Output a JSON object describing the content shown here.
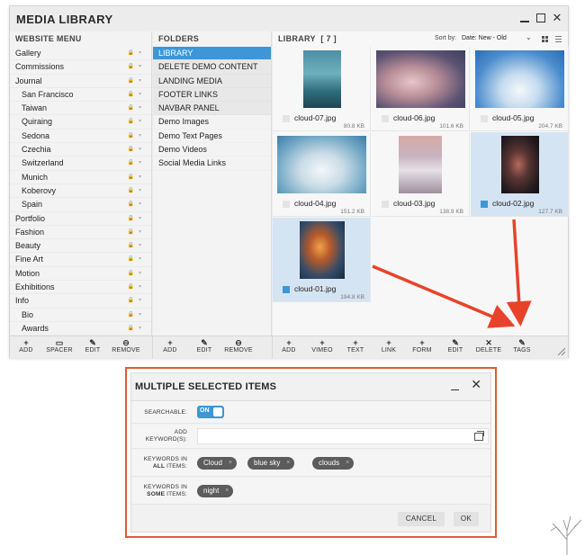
{
  "window": {
    "title": "MEDIA LIBRARY"
  },
  "website_menu": {
    "heading": "WEBSITE MENU",
    "items": [
      {
        "label": "Gallery",
        "sub": false
      },
      {
        "label": "Commissions",
        "sub": false
      },
      {
        "label": "Journal",
        "sub": false
      },
      {
        "label": "San Francisco",
        "sub": true
      },
      {
        "label": "Taiwan",
        "sub": true
      },
      {
        "label": "Quiraing",
        "sub": true
      },
      {
        "label": "Sedona",
        "sub": true
      },
      {
        "label": "Czechia",
        "sub": true
      },
      {
        "label": "Switzerland",
        "sub": true
      },
      {
        "label": "Munich",
        "sub": true
      },
      {
        "label": "Koberovy",
        "sub": true
      },
      {
        "label": "Spain",
        "sub": true
      },
      {
        "label": "Portfolio",
        "sub": false
      },
      {
        "label": "Fashion",
        "sub": false
      },
      {
        "label": "Beauty",
        "sub": false
      },
      {
        "label": "Fine Art",
        "sub": false
      },
      {
        "label": "Motion",
        "sub": false
      },
      {
        "label": "Exhibitions",
        "sub": false
      },
      {
        "label": "Info",
        "sub": false
      },
      {
        "label": "Bio",
        "sub": true
      },
      {
        "label": "Awards",
        "sub": true
      }
    ]
  },
  "folders": {
    "heading": "FOLDERS",
    "items": [
      {
        "label": "LIBRARY",
        "style": "active"
      },
      {
        "label": "DELETE DEMO CONTENT",
        "style": "upper"
      },
      {
        "label": "LANDING MEDIA",
        "style": "upper"
      },
      {
        "label": "FOOTER LINKS",
        "style": "upper"
      },
      {
        "label": "NAVBAR PANEL",
        "style": "upper"
      },
      {
        "label": "Demo Images",
        "style": "plain"
      },
      {
        "label": "Demo Text Pages",
        "style": "plain"
      },
      {
        "label": "Demo Videos",
        "style": "plain"
      },
      {
        "label": "Social Media Links",
        "style": "plain"
      }
    ]
  },
  "library": {
    "heading": "LIBRARY",
    "count": "[ 7 ]",
    "sort_label": "Sort by:",
    "sort_value": "Date: New - Old",
    "items": [
      {
        "name": "cloud-07.jpg",
        "size": "80.8 KB",
        "selected": false,
        "thumb": "t7"
      },
      {
        "name": "cloud-06.jpg",
        "size": "101.6 KB",
        "selected": false,
        "thumb": "t6"
      },
      {
        "name": "cloud-05.jpg",
        "size": "204.7 KB",
        "selected": false,
        "thumb": "t5"
      },
      {
        "name": "cloud-04.jpg",
        "size": "151.2 KB",
        "selected": false,
        "thumb": "t4"
      },
      {
        "name": "cloud-03.jpg",
        "size": "138.9 KB",
        "selected": false,
        "thumb": "t3"
      },
      {
        "name": "cloud-02.jpg",
        "size": "127.7 KB",
        "selected": true,
        "thumb": "t2"
      },
      {
        "name": "cloud-01.jpg",
        "size": "194.8 KB",
        "selected": true,
        "thumb": "t1"
      }
    ]
  },
  "toolbar": {
    "menu": [
      {
        "icon": "+",
        "label": "ADD",
        "name": "menu-add-button",
        "glyph": "plus-icon"
      },
      {
        "icon": "▭",
        "label": "SPACER",
        "name": "menu-spacer-button",
        "glyph": "spacer-icon"
      },
      {
        "icon": "✎",
        "label": "EDIT",
        "name": "menu-edit-button",
        "glyph": "pencil-icon"
      },
      {
        "icon": "⊖",
        "label": "REMOVE",
        "name": "menu-remove-button",
        "glyph": "minus-circle-icon"
      }
    ],
    "folders": [
      {
        "icon": "+",
        "label": "ADD",
        "name": "folder-add-button",
        "glyph": "plus-icon"
      },
      {
        "icon": "✎",
        "label": "EDIT",
        "name": "folder-edit-button",
        "glyph": "pencil-icon"
      },
      {
        "icon": "⊖",
        "label": "REMOVE",
        "name": "folder-remove-button",
        "glyph": "minus-circle-icon"
      }
    ],
    "library": [
      {
        "icon": "+",
        "label": "ADD",
        "name": "library-add-button",
        "glyph": "plus-icon"
      },
      {
        "icon": "+",
        "label": "VIMEO",
        "name": "library-vimeo-button",
        "glyph": "plus-icon"
      },
      {
        "icon": "+",
        "label": "TEXT",
        "name": "library-text-button",
        "glyph": "plus-icon"
      },
      {
        "icon": "+",
        "label": "LINK",
        "name": "library-link-button",
        "glyph": "plus-icon"
      },
      {
        "icon": "+",
        "label": "FORM",
        "name": "library-form-button",
        "glyph": "plus-icon"
      },
      {
        "icon": "✎",
        "label": "EDIT",
        "name": "library-edit-button",
        "glyph": "pencil-icon"
      },
      {
        "icon": "✕",
        "label": "DELETE",
        "name": "library-delete-button",
        "glyph": "close-icon"
      },
      {
        "icon": "✎",
        "label": "TAGS",
        "name": "library-tags-button",
        "glyph": "pencil-icon"
      }
    ]
  },
  "dialog": {
    "title": "MULTIPLE SELECTED ITEMS",
    "searchable_label": "SEARCHABLE:",
    "searchable_state": "ON",
    "add_keywords_label_1": "ADD",
    "add_keywords_label_2": "KEYWORD(S):",
    "add_keywords_value": "",
    "all_label_1": "KEYWORDS IN",
    "all_label_2_bold": "ALL",
    "all_label_2_rest": " ITEMS:",
    "all_keywords": [
      "Cloud",
      "blue sky",
      "clouds"
    ],
    "some_label_1": "KEYWORDS IN",
    "some_label_2_bold": "SOME",
    "some_label_2_rest": " ITEMS:",
    "some_keywords": [
      "night"
    ],
    "cancel_label": "CANCEL",
    "ok_label": "OK"
  },
  "colors": {
    "accent": "#3d97d6",
    "arrow": "#e8432a",
    "selected_tile": "#d5e4f3"
  }
}
